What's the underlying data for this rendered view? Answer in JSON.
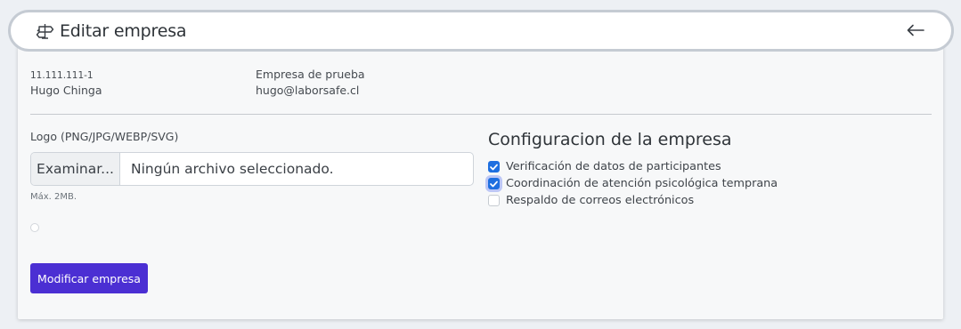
{
  "header": {
    "title": "Editar empresa",
    "title_icon": "signpost-icon",
    "back_icon": "arrow-left-icon"
  },
  "company": {
    "rut": "11.111.111-1",
    "name": "Empresa de prueba",
    "contact_name": "Hugo Chinga",
    "contact_email": "hugo@laborsafe.cl"
  },
  "logo": {
    "label": "Logo (PNG/JPG/WEBP/SVG)",
    "browse_label": "Examinar...",
    "file_value": "Ningún archivo seleccionado.",
    "help": "Máx. 2MB."
  },
  "config": {
    "title": "Configuracion de la empresa",
    "options": [
      {
        "label": "Verificación de datos de participantes",
        "checked": true
      },
      {
        "label": "Coordinación de atención psicológica temprana",
        "checked": true
      },
      {
        "label": "Respaldo de correos electrónicos",
        "checked": false
      }
    ]
  },
  "actions": {
    "submit_label": "Modificar empresa"
  },
  "colors": {
    "primary": "#4b2fd3",
    "checkbox": "#1e6fe0"
  }
}
